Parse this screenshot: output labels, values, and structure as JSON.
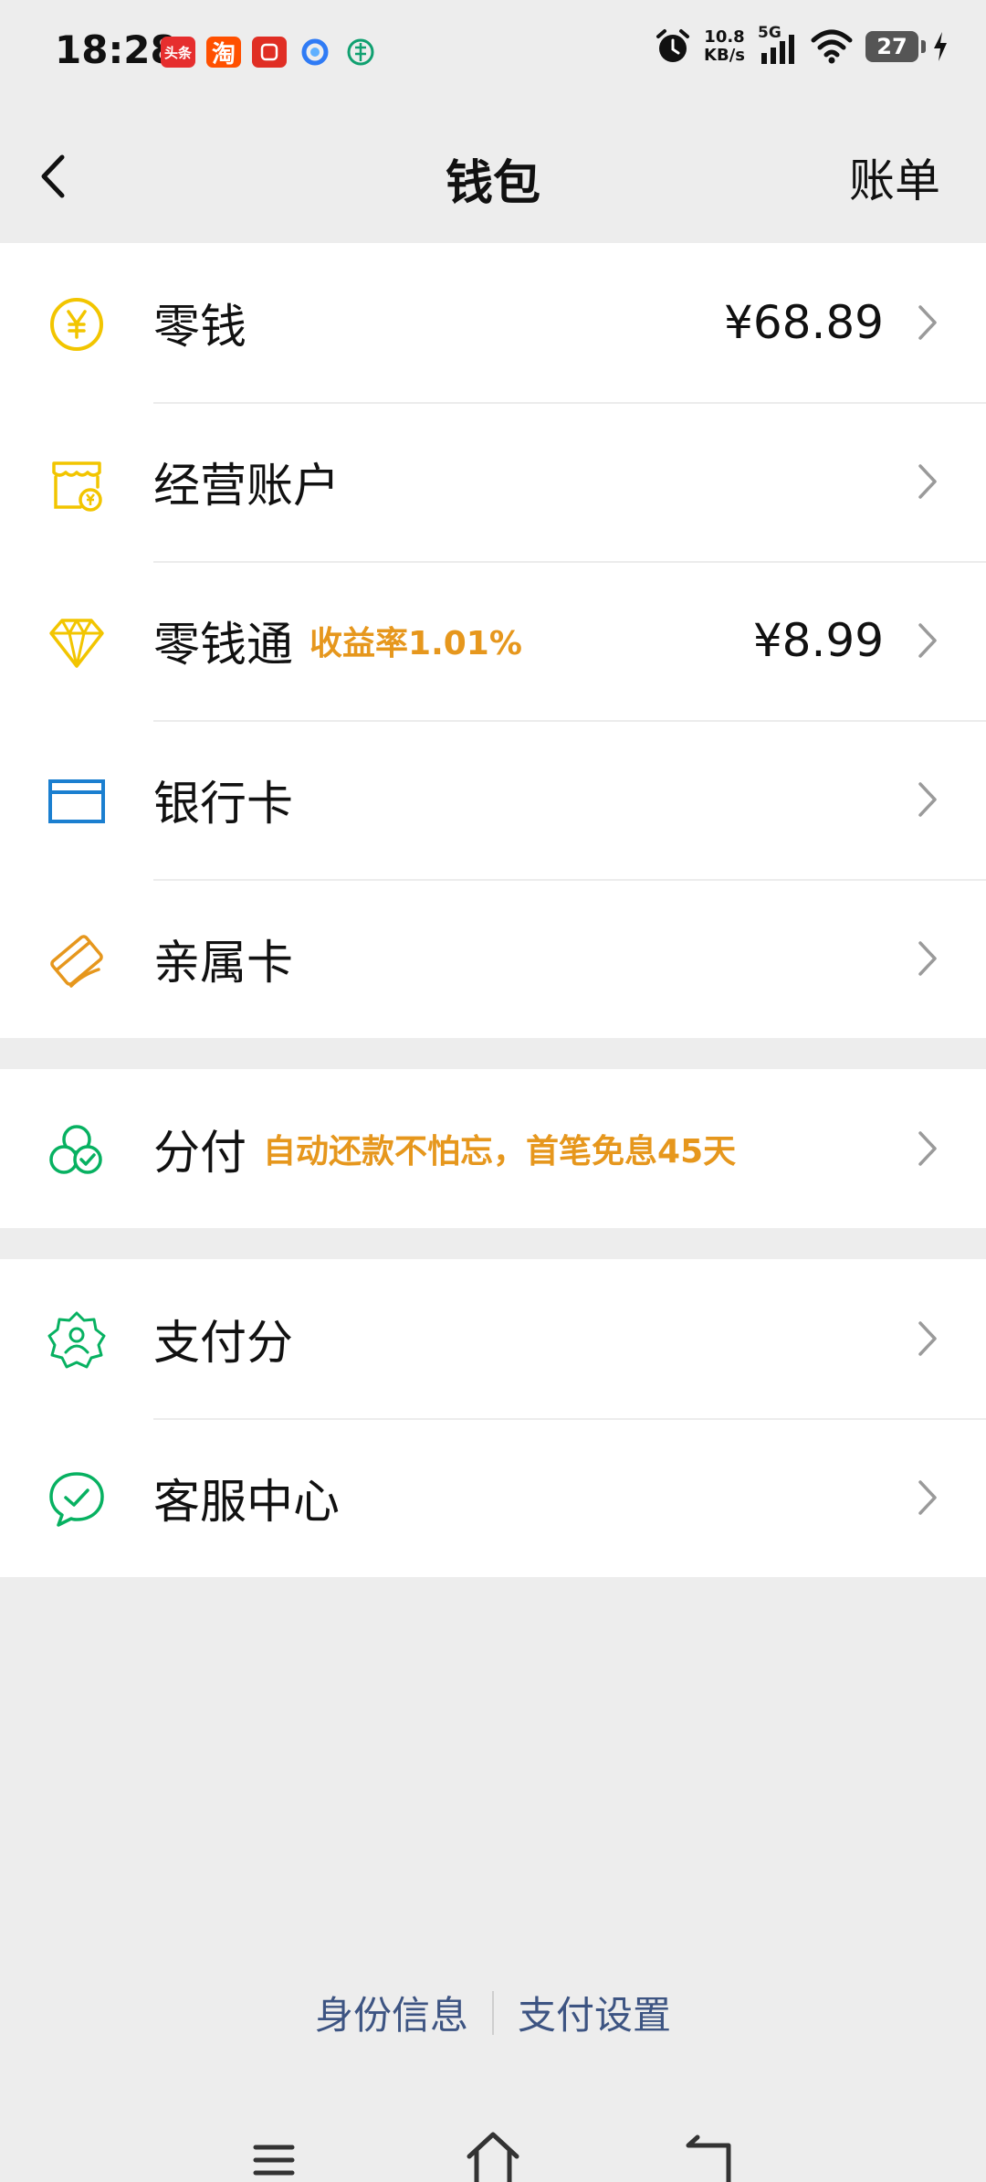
{
  "status_bar": {
    "time": "18:28",
    "apps": [
      {
        "name": "toutiao-app-icon",
        "label": "头条",
        "color": "#e62e2e"
      },
      {
        "name": "taobao-app-icon",
        "label": "淘",
        "color": "#ff5000"
      },
      {
        "name": "pinduoduo-app-icon",
        "label": "",
        "color": "#e02e24"
      },
      {
        "name": "browser-app-icon",
        "label": "",
        "color": "#2f7bf5"
      },
      {
        "name": "bank-app-icon",
        "label": "",
        "color": "#10a070"
      }
    ],
    "net_speed_value": "10.8",
    "net_speed_unit": "KB/s",
    "signal_label": "5G",
    "battery": "27"
  },
  "nav": {
    "title": "钱包",
    "bill": "账单"
  },
  "group1": [
    {
      "name": "change",
      "icon": "yen-coin-icon",
      "label": "零钱",
      "sub": "",
      "value": "¥68.89"
    },
    {
      "name": "business-account",
      "icon": "shop-icon",
      "label": "经营账户",
      "sub": "",
      "value": ""
    },
    {
      "name": "lqt",
      "icon": "diamond-icon",
      "label": "零钱通",
      "sub": "收益率1.01%",
      "value": "¥8.99"
    },
    {
      "name": "bank-card",
      "icon": "bank-card-icon",
      "label": "银行卡",
      "sub": "",
      "value": ""
    },
    {
      "name": "family-card",
      "icon": "family-card-icon",
      "label": "亲属卡",
      "sub": "",
      "value": ""
    }
  ],
  "group2": [
    {
      "name": "installment",
      "icon": "installment-icon",
      "label": "分付",
      "sub": "自动还款不怕忘，首笔免息45天",
      "value": ""
    }
  ],
  "group3": [
    {
      "name": "pay-score",
      "icon": "pay-score-icon",
      "label": "支付分",
      "sub": "",
      "value": ""
    },
    {
      "name": "customer-service",
      "icon": "customer-service-icon",
      "label": "客服中心",
      "sub": "",
      "value": ""
    }
  ],
  "footer": {
    "identity": "身份信息",
    "pay_settings": "支付设置"
  },
  "colors": {
    "yellow": "#f2c500",
    "blue": "#1b7fd0",
    "orange": "#e6971d",
    "green": "#07b161",
    "link": "#3d5482"
  }
}
